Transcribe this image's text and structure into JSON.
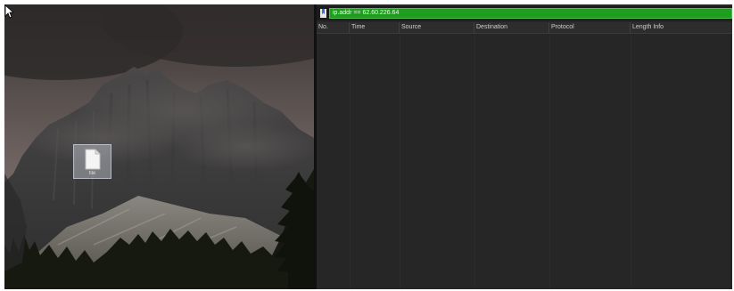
{
  "desktop": {
    "file_label": "file",
    "icons": [
      "document-icon",
      "mouse-cursor-icon"
    ]
  },
  "capture": {
    "filter": {
      "value": "ip.addr == 62.60.226.64",
      "color": "#1f9d1f"
    },
    "columns": [
      "No.",
      "Time",
      "Source",
      "Destination",
      "Protocol",
      "Length Info"
    ],
    "rows": []
  }
}
